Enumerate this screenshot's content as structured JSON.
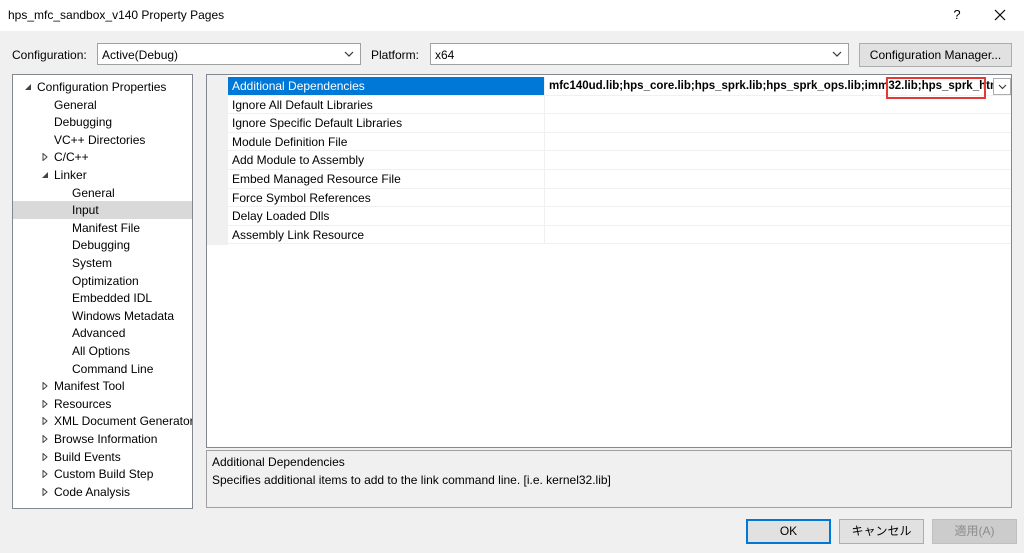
{
  "window": {
    "title": "hps_mfc_sandbox_v140 Property Pages",
    "help_label": "?"
  },
  "toolbar": {
    "configuration_label": "Configuration:",
    "configuration_value": "Active(Debug)",
    "platform_label": "Platform:",
    "platform_value": "x64",
    "config_manager_label": "Configuration Manager..."
  },
  "tree": {
    "items": [
      {
        "label": "Configuration Properties",
        "level": 0,
        "expander": "expanded"
      },
      {
        "label": "General",
        "level": 1,
        "expander": "none"
      },
      {
        "label": "Debugging",
        "level": 1,
        "expander": "none"
      },
      {
        "label": "VC++ Directories",
        "level": 1,
        "expander": "none"
      },
      {
        "label": "C/C++",
        "level": 1,
        "expander": "collapsed"
      },
      {
        "label": "Linker",
        "level": 1,
        "expander": "expanded"
      },
      {
        "label": "General",
        "level": 2,
        "expander": "none"
      },
      {
        "label": "Input",
        "level": 2,
        "expander": "none",
        "selected": true
      },
      {
        "label": "Manifest File",
        "level": 2,
        "expander": "none"
      },
      {
        "label": "Debugging",
        "level": 2,
        "expander": "none"
      },
      {
        "label": "System",
        "level": 2,
        "expander": "none"
      },
      {
        "label": "Optimization",
        "level": 2,
        "expander": "none"
      },
      {
        "label": "Embedded IDL",
        "level": 2,
        "expander": "none"
      },
      {
        "label": "Windows Metadata",
        "level": 2,
        "expander": "none"
      },
      {
        "label": "Advanced",
        "level": 2,
        "expander": "none"
      },
      {
        "label": "All Options",
        "level": 2,
        "expander": "none"
      },
      {
        "label": "Command Line",
        "level": 2,
        "expander": "none"
      },
      {
        "label": "Manifest Tool",
        "level": 1,
        "expander": "collapsed"
      },
      {
        "label": "Resources",
        "level": 1,
        "expander": "collapsed"
      },
      {
        "label": "XML Document Generator",
        "level": 1,
        "expander": "collapsed"
      },
      {
        "label": "Browse Information",
        "level": 1,
        "expander": "collapsed"
      },
      {
        "label": "Build Events",
        "level": 1,
        "expander": "collapsed"
      },
      {
        "label": "Custom Build Step",
        "level": 1,
        "expander": "collapsed"
      },
      {
        "label": "Code Analysis",
        "level": 1,
        "expander": "collapsed"
      }
    ]
  },
  "grid": {
    "rows": [
      {
        "name": "Additional Dependencies",
        "value_main": "mfc140ud.lib;hps_core.lib;hps_sprk.lib;hps_sprk_ops.lib;imm32.lib;",
        "value_highlight": "hps_sprk_html.lib",
        "selected": true
      },
      {
        "name": "Ignore All Default Libraries",
        "value_main": ""
      },
      {
        "name": "Ignore Specific Default Libraries",
        "value_main": ""
      },
      {
        "name": "Module Definition File",
        "value_main": ""
      },
      {
        "name": "Add Module to Assembly",
        "value_main": ""
      },
      {
        "name": "Embed Managed Resource File",
        "value_main": ""
      },
      {
        "name": "Force Symbol References",
        "value_main": ""
      },
      {
        "name": "Delay Loaded Dlls",
        "value_main": ""
      },
      {
        "name": "Assembly Link Resource",
        "value_main": ""
      }
    ]
  },
  "description": {
    "title": "Additional Dependencies",
    "body": "Specifies additional items to add to the link command line. [i.e. kernel32.lib]"
  },
  "footer": {
    "ok_label": "OK",
    "cancel_label": "キャンセル",
    "apply_label": "適用(A)"
  },
  "colors": {
    "selection": "#0078d7",
    "highlight_border": "#e53935",
    "tree_selected": "#d9d9d9"
  }
}
